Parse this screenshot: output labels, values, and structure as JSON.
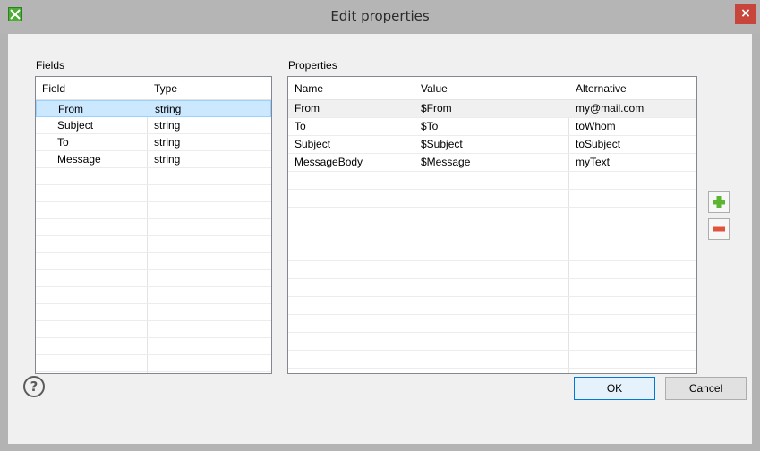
{
  "window": {
    "title": "Edit properties",
    "close_glyph": "×",
    "app_icon": "app-logo-icon"
  },
  "fields_panel": {
    "label": "Fields",
    "columns": [
      "Field",
      "Type"
    ],
    "rows": [
      {
        "field": "From",
        "type": "string"
      },
      {
        "field": "Subject",
        "type": "string"
      },
      {
        "field": "To",
        "type": "string"
      },
      {
        "field": "Message",
        "type": "string"
      }
    ],
    "selected_row": "From"
  },
  "properties_panel": {
    "label": "Properties",
    "columns": [
      "Name",
      "Value",
      "Alternative"
    ],
    "rows": [
      {
        "name": "From",
        "value": "$From",
        "alternative": "my@mail.com"
      },
      {
        "name": "To",
        "value": "$To",
        "alternative": "toWhom"
      },
      {
        "name": "Subject",
        "value": "$Subject",
        "alternative": "toSubject"
      },
      {
        "name": "MessageBody",
        "value": "$Message",
        "alternative": "myText"
      }
    ],
    "add_icon": "plus-icon",
    "remove_icon": "minus-icon"
  },
  "footer": {
    "help_glyph": "?",
    "ok_label": "OK",
    "cancel_label": "Cancel"
  },
  "colors": {
    "selection": "#cce8ff",
    "add_green": "#5cb531",
    "remove_red": "#e0533d",
    "close_red": "#c7453b"
  }
}
